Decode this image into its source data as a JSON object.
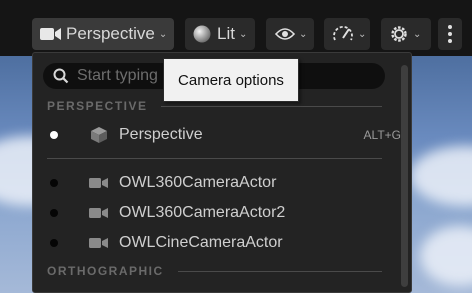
{
  "toolbar": {
    "perspective_label": "Perspective",
    "lit_label": "Lit"
  },
  "menu": {
    "search_placeholder": "Start typing",
    "sections": {
      "perspective": "PERSPECTIVE",
      "orthographic": "ORTHOGRAPHIC"
    },
    "perspective_item": {
      "label": "Perspective",
      "shortcut": "ALT+G",
      "selected": true
    },
    "camera_items": [
      {
        "label": "OWL360CameraActor"
      },
      {
        "label": "OWL360CameraActor2"
      },
      {
        "label": "OWLCineCameraActor"
      }
    ]
  },
  "tooltip": {
    "text": "Camera options"
  },
  "colors": {
    "toolbar_bg": "#151515",
    "button_bg": "#2a2a2a",
    "menu_bg": "#232323",
    "text": "#cfcfcf",
    "muted": "#6a6a6a",
    "selected_dot": "#ffffff",
    "unselected_dot": "#000000"
  }
}
